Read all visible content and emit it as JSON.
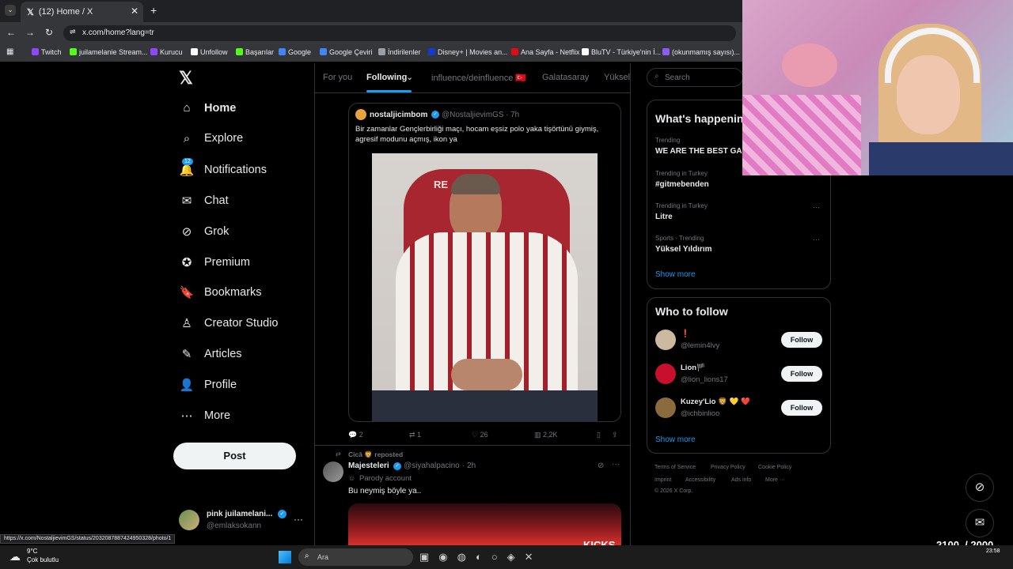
{
  "browser": {
    "tab_title": "(12) Home / X",
    "url": "x.com/home?lang=tr",
    "bookmarks": [
      {
        "label": "Twitch",
        "color": "#9146ff"
      },
      {
        "label": "juilamelanie Stream...",
        "color": "#53fc18"
      },
      {
        "label": "Kurucu",
        "color": "#9146ff"
      },
      {
        "label": "Unfollow",
        "color": "#ffffff"
      },
      {
        "label": "Başarılar",
        "color": "#53fc18"
      },
      {
        "label": "Google",
        "color": "#4285f4"
      },
      {
        "label": "Google Çeviri",
        "color": "#4285f4"
      },
      {
        "label": "İndirilenler",
        "color": "#9aa0a6"
      },
      {
        "label": "Disney+ | Movies an...",
        "color": "#113ccf"
      },
      {
        "label": "Ana Sayfa - Netflix",
        "color": "#e50914"
      },
      {
        "label": "BluTV - Türkiye'nin İ...",
        "color": "#ffffff"
      },
      {
        "label": "(okunmamış sayısı)...",
        "color": "#8b5cf6"
      }
    ]
  },
  "nav": {
    "items": [
      "Home",
      "Explore",
      "Notifications",
      "Chat",
      "Grok",
      "Premium",
      "Bookmarks",
      "Creator Studio",
      "Articles",
      "Profile",
      "More"
    ],
    "notif_badge": "12",
    "post_label": "Post",
    "account_name": "pink juilamelani...",
    "account_handle": "@emlaksokann"
  },
  "feed": {
    "tabs": [
      "For you",
      "Following",
      "influence/deinfluence 🇹🇷",
      "Galatasaray",
      "Yüksel"
    ],
    "post1": {
      "name": "nostaljicimbom",
      "handle": "@NostaljievimGS",
      "time": "· 7h",
      "text": "Bir zamanlar Gençlerbirliği maçı,  hocam eşsiz polo yaka tişörtünü giymiş, agresif modunu açmış, ikon ya",
      "replies": "2",
      "reposts": "1",
      "likes": "26",
      "views": "2,2K"
    },
    "repost_label": "Cicâ 🦁 reposted",
    "post2": {
      "name": "Majesteleri",
      "handle": "@siyahalpacino",
      "time": "· 2h",
      "badge": "Parody account",
      "text": "Bu neymiş böyle ya.."
    }
  },
  "right": {
    "search_placeholder": "Search",
    "happening_title": "What's happening",
    "trends": [
      {
        "context": "Trending",
        "name": "WE ARE THE BEST GAL"
      },
      {
        "context": "Trending in Turkey",
        "name": "#gitmebenden"
      },
      {
        "context": "Trending in Turkey",
        "name": "Litre"
      },
      {
        "context": "Sports · Trending",
        "name": "Yüksel Yıldırım"
      }
    ],
    "show_more": "Show more",
    "wtf_title": "Who to follow",
    "follow_label": "Follow",
    "accounts": [
      {
        "name": "❗",
        "handle": "@lemin4lvy"
      },
      {
        "name": "Lion🏴",
        "handle": "@lion_lions17"
      },
      {
        "name": "Kuzey'Lio 🦁 💛 ❤️",
        "handle": "@ichbinlioo"
      }
    ],
    "footer": [
      "Terms of Service",
      "Privacy Policy",
      "Cookie Policy",
      "Imprint",
      "Accessibility",
      "Ads info",
      "More ···",
      "© 2026 X Corp."
    ]
  },
  "overlay": {
    "kicks_label": "KICKS",
    "kicks_count": "2100  / 2000"
  },
  "status_url": "https://x.com/NostaljievimGS/status/2032087887424950328/photo/1",
  "taskbar": {
    "temp": "9°C",
    "weather": "Çok bulutlu",
    "search_placeholder": "Ara",
    "time": "23:58"
  }
}
